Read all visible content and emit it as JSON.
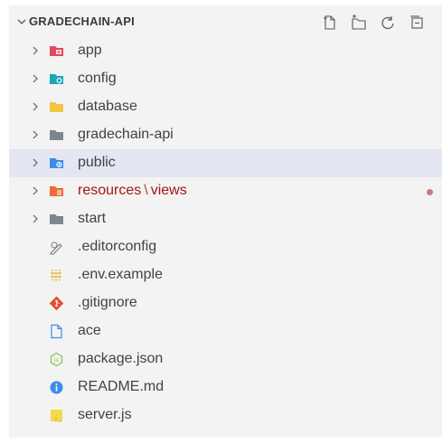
{
  "explorer": {
    "title": "GRADECHAIN-API",
    "actions": [
      {
        "name": "new-file-icon"
      },
      {
        "name": "new-folder-icon"
      },
      {
        "name": "refresh-icon"
      },
      {
        "name": "collapse-all-icon"
      }
    ],
    "items": [
      {
        "type": "folder",
        "label": "app",
        "icon": "app-folder-icon",
        "color": "#e04b5b"
      },
      {
        "type": "folder",
        "label": "config",
        "icon": "config-folder-icon",
        "color": "#19a6b6"
      },
      {
        "type": "folder",
        "label": "database",
        "icon": "database-folder-icon",
        "color": "#f4c542"
      },
      {
        "type": "folder",
        "label": "gradechain-api",
        "icon": "folder-icon",
        "color": "#7d868e"
      },
      {
        "type": "folder",
        "label": "public",
        "icon": "public-folder-icon",
        "color": "#3a8ee6",
        "selected": true
      },
      {
        "type": "folder",
        "label": "resources",
        "sublabel": "views",
        "separator": "\\",
        "icon": "resources-folder-icon",
        "color": "#ef6a3a",
        "modified": true
      },
      {
        "type": "folder",
        "label": "start",
        "icon": "folder-icon",
        "color": "#7d868e"
      },
      {
        "type": "file",
        "label": ".editorconfig",
        "icon": "editorconfig-icon"
      },
      {
        "type": "file",
        "label": ".env.example",
        "icon": "env-file-icon"
      },
      {
        "type": "file",
        "label": ".gitignore",
        "icon": "git-icon"
      },
      {
        "type": "file",
        "label": "ace",
        "icon": "file-icon"
      },
      {
        "type": "file",
        "label": "package.json",
        "icon": "nodejs-icon"
      },
      {
        "type": "file",
        "label": "README.md",
        "icon": "info-icon"
      },
      {
        "type": "file",
        "label": "server.js",
        "icon": "js-file-icon"
      }
    ]
  }
}
